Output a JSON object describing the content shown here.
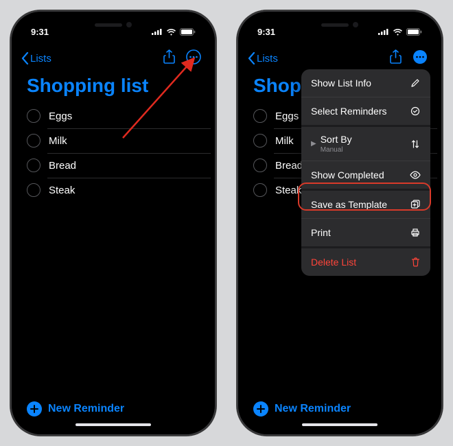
{
  "status": {
    "time": "9:31"
  },
  "nav": {
    "back": "Lists"
  },
  "list": {
    "title": "Shopping list",
    "items": [
      "Eggs",
      "Milk",
      "Bread",
      "Steak"
    ]
  },
  "new_reminder": "New Reminder",
  "menu": {
    "show_list_info": "Show List Info",
    "select_reminders": "Select Reminders",
    "sort_by": "Sort By",
    "sort_by_value": "Manual",
    "show_completed": "Show Completed",
    "save_as_template": "Save as Template",
    "print": "Print",
    "delete_list": "Delete List"
  }
}
